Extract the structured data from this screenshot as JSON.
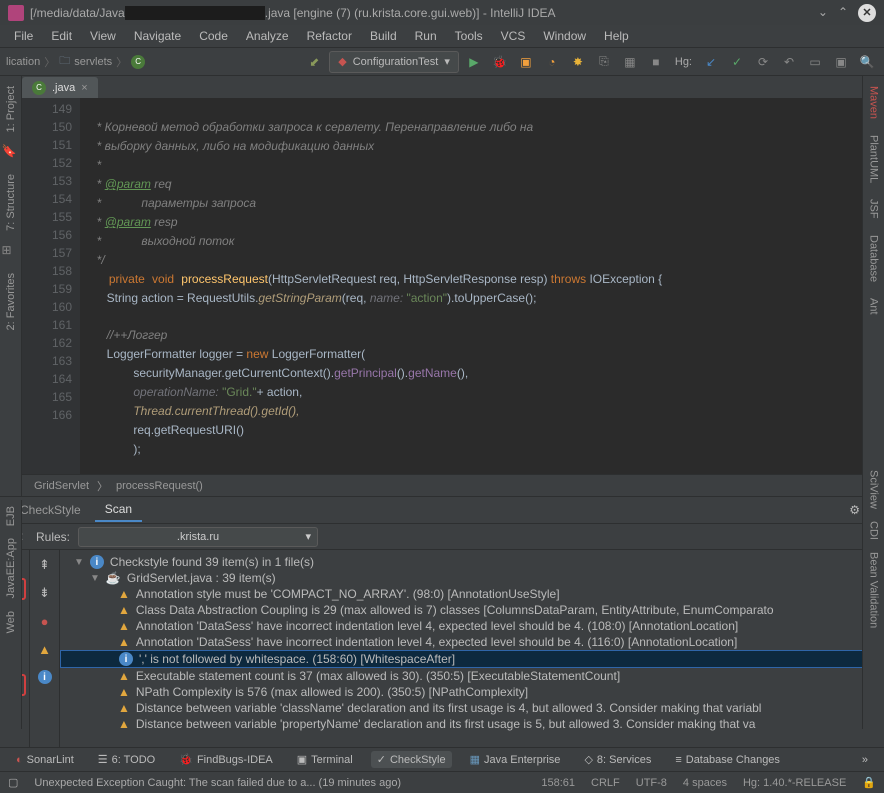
{
  "title": {
    "prefix": "[/media/data/Java",
    "suffix": ".java [engine (7) (ru.krista.core.gui.web)] - IntelliJ IDEA"
  },
  "menu": [
    "File",
    "Edit",
    "View",
    "Navigate",
    "Code",
    "Analyze",
    "Refactor",
    "Build",
    "Run",
    "Tools",
    "VCS",
    "Window",
    "Help"
  ],
  "breadcrumb": {
    "item1": "lication",
    "item2": "servlets",
    "item3": "C"
  },
  "runconfig": {
    "label": "ConfigurationTest"
  },
  "hg": {
    "label": "Hg:"
  },
  "editor_tab": {
    "name": ".java"
  },
  "code": {
    "lines": [
      "149",
      "150",
      "151",
      "152",
      "153",
      "154",
      "155",
      "156",
      "157",
      "158",
      "159",
      "160",
      "161",
      "162",
      "163",
      "164",
      "165",
      "166"
    ]
  },
  "code_text": {
    "l149": "     * Корневой метод обработки запроса к сервлету. Перенаправление либо на",
    "l150": "     * выборку данных, либо на модификацию данных",
    "l151": "     *",
    "l152a": "     * ",
    "l152b": "@param",
    "l152c": " req",
    "l153": "     *            параметры запроса",
    "l154a": "     * ",
    "l154b": "@param",
    "l154c": " resp",
    "l155": "     *            выходной поток",
    "l156": "     */",
    "l157_kw1": "private",
    "l157_kw2": "void",
    "l157_m": "processRequest",
    "l157_sig": "(HttpServletRequest req, HttpServletResponse resp) ",
    "l157_kw3": "throws",
    "l157_ex": " IOException {",
    "l158a": "        String action = RequestUtils.",
    "l158b": "getStringParam",
    "l158c": "(req, ",
    "l158d": "name: ",
    "l158e": "\"action\"",
    "l158f": ").toUpperCase();",
    "l160": "        //++Логгер",
    "l161a": "        LoggerFormatter logger = ",
    "l161b": "new",
    "l161c": " LoggerFormatter(",
    "l162a": "                securityManager.getCurrentContext().",
    "l162b": "getPrincipal",
    "l162c": "().",
    "l162d": "getName",
    "l162e": "(),",
    "l163a": "                ",
    "l163b": "operationName: ",
    "l163c": "\"Grid.\"",
    "l163d": "+ action,",
    "l164": "                Thread.currentThread().getId(),",
    "l165": "                req.getRequestURI()",
    "l166": "                );"
  },
  "crumbs": {
    "a": "GridServlet",
    "b": "processRequest()"
  },
  "panel": {
    "tab1": "CheckStyle",
    "tab2": "Scan",
    "rules_label": "Rules:",
    "rules_value": ".krista.ru"
  },
  "rail_left": {
    "project": "1: Project",
    "structure": "7: Structure",
    "favorites": "2: Favorites",
    "ejb": "EJB",
    "jee": "JavaEE:App",
    "web": "Web"
  },
  "rail_right": {
    "maven": "Maven",
    "plantuml": "PlantUML",
    "jsf": "JSF",
    "database": "Database",
    "ant": "Ant",
    "sciview": "SciView",
    "cdi": "CDI",
    "bean": "Bean Validation"
  },
  "results": {
    "root": "Checkstyle found 39 item(s) in 1 file(s)",
    "file": "GridServlet.java : 39 item(s)",
    "items": [
      "Annotation style must be 'COMPACT_NO_ARRAY'. (98:0) [AnnotationUseStyle]",
      "Class Data Abstraction Coupling is 29 (max allowed is 7) classes [ColumnsDataParam, EntityAttribute, EnumComparato",
      "Annotation 'DataSess' have incorrect indentation level 4, expected level should be 4. (108:0) [AnnotationLocation]",
      "Annotation 'DataSess' have incorrect indentation level 4, expected level should be 4. (116:0) [AnnotationLocation]",
      "',' is not followed by whitespace. (158:60) [WhitespaceAfter]",
      "Executable statement count is 37 (max allowed is 30). (350:5) [ExecutableStatementCount]",
      "NPath Complexity is 576 (max allowed is 200). (350:5) [NPathComplexity]",
      "Distance between variable 'className' declaration and its first usage is 4, but allowed 3.  Consider making that variabl",
      "Distance between variable 'propertyName' declaration and its first usage is 5, but allowed 3.  Consider making that va"
    ],
    "selected_index": 4
  },
  "bottom": {
    "sonarlint": "SonarLint",
    "todo": "6: TODO",
    "findbugs": "FindBugs-IDEA",
    "terminal": "Terminal",
    "checkstyle": "CheckStyle",
    "javaee": "Java Enterprise",
    "services": "8: Services",
    "dbchanges": "Database Changes"
  },
  "status": {
    "msg": "Unexpected Exception Caught: The scan failed due to a... (19 minutes ago)",
    "pos": "158:61",
    "eol": "CRLF",
    "enc": "UTF-8",
    "indent": "4 spaces",
    "hg": "Hg: 1.40.*-RELEASE"
  }
}
